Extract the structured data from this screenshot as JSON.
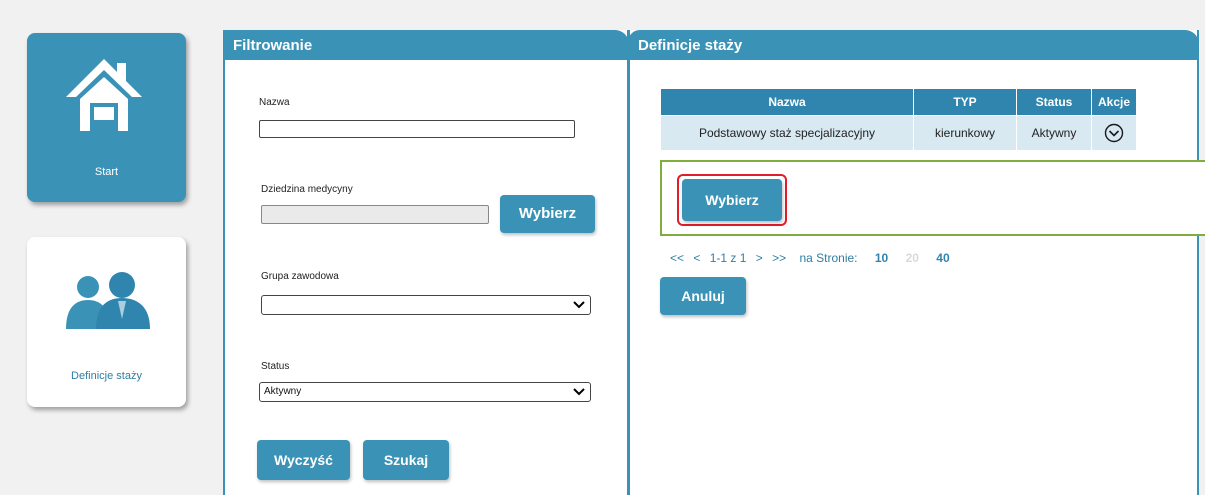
{
  "sidebar": {
    "start": {
      "label": "Start",
      "icon": "home-icon"
    },
    "definitions": {
      "label": "Definicje staży",
      "icon": "users-icon"
    }
  },
  "filter": {
    "title": "Filtrowanie",
    "name_label": "Nazwa",
    "name_value": "",
    "field_label": "Dziedzina medycyny",
    "field_value": "",
    "field_button": "Wybierz",
    "group_label": "Grupa zawodowa",
    "group_value": "",
    "status_label": "Status",
    "status_value": "Aktywny",
    "clear_button": "Wyczyść",
    "search_button": "Szukaj"
  },
  "defs": {
    "title": "Definicje staży",
    "columns": {
      "name": "Nazwa",
      "type": "TYP",
      "status": "Status",
      "actions": "Akcje"
    },
    "rows": [
      {
        "name": "Podstawowy staż specjalizacyjny",
        "type": "kierunkowy",
        "status": "Aktywny",
        "action_icon": "chevron-circle-down-icon"
      }
    ],
    "select_button": "Wybierz",
    "pager": {
      "first": "<<",
      "prev": "<",
      "range": "1-1 z 1",
      "next": ">",
      "last": ">>",
      "per_page_label": "na Stronie:",
      "sizes": [
        "10",
        "20",
        "40"
      ],
      "current_size": "10"
    },
    "cancel_button": "Anuluj"
  },
  "colors": {
    "accent": "#3a93b7",
    "table_header": "#2f85ae",
    "row_bg": "#d8e9f2",
    "expanded_border": "#7fae3e",
    "highlight": "#e21c2a"
  }
}
